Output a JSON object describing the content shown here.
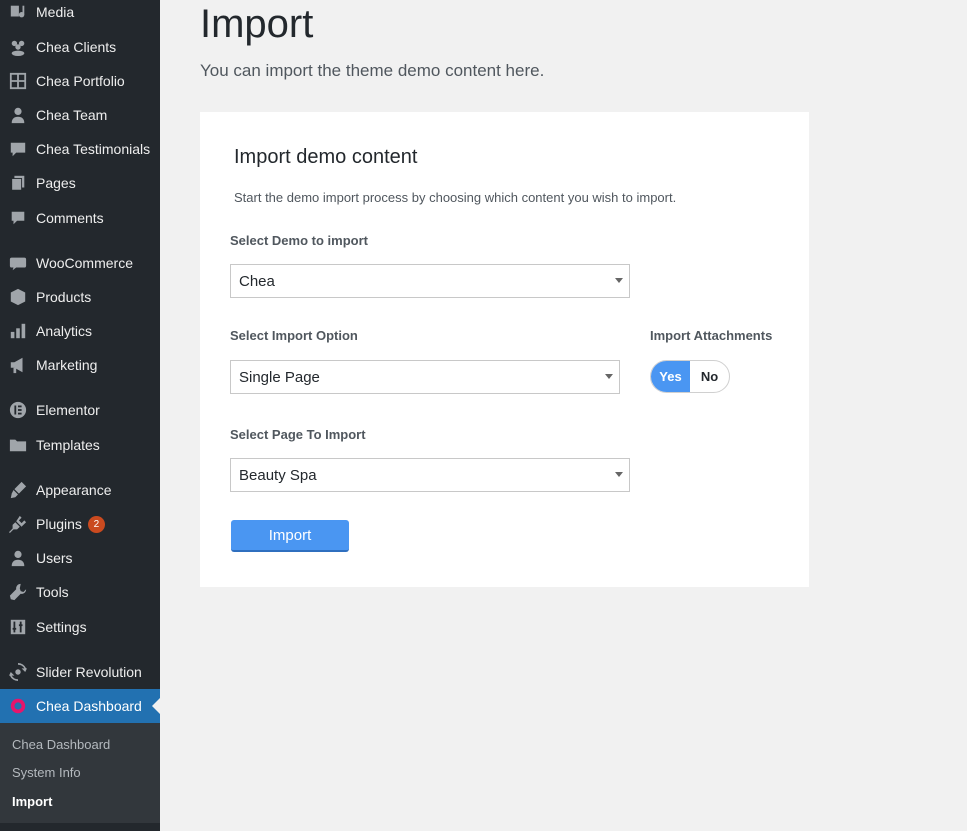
{
  "sidebar": {
    "items": [
      {
        "label": "Media",
        "icon": "media-icon"
      },
      {
        "label": "Chea Clients",
        "icon": "clients-icon"
      },
      {
        "label": "Chea Portfolio",
        "icon": "portfolio-icon"
      },
      {
        "label": "Chea Team",
        "icon": "team-icon"
      },
      {
        "label": "Chea Testimonials",
        "icon": "testimonials-icon"
      },
      {
        "label": "Pages",
        "icon": "pages-icon"
      },
      {
        "label": "Comments",
        "icon": "comments-icon"
      },
      {
        "label": "WooCommerce",
        "icon": "woocommerce-icon"
      },
      {
        "label": "Products",
        "icon": "products-icon"
      },
      {
        "label": "Analytics",
        "icon": "analytics-icon"
      },
      {
        "label": "Marketing",
        "icon": "marketing-icon"
      },
      {
        "label": "Elementor",
        "icon": "elementor-icon"
      },
      {
        "label": "Templates",
        "icon": "templates-icon"
      },
      {
        "label": "Appearance",
        "icon": "appearance-icon"
      },
      {
        "label": "Plugins",
        "icon": "plugins-icon",
        "badge": "2"
      },
      {
        "label": "Users",
        "icon": "users-icon"
      },
      {
        "label": "Tools",
        "icon": "tools-icon"
      },
      {
        "label": "Settings",
        "icon": "settings-icon"
      },
      {
        "label": "Slider Revolution",
        "icon": "slider-revolution-icon"
      },
      {
        "label": "Chea Dashboard",
        "icon": "chea-dashboard-icon",
        "active": true
      }
    ],
    "submenu": [
      "Chea Dashboard",
      "System Info",
      "Import"
    ],
    "submenu_current": "Import"
  },
  "page": {
    "title": "Import",
    "subtitle": "You can import the theme demo content here."
  },
  "panel": {
    "title": "Import demo content",
    "description": "Start the demo import process by choosing which content you wish to import.",
    "demo_label": "Select Demo to import",
    "demo_value": "Chea",
    "option_label": "Select Import Option",
    "option_value": "Single Page",
    "attachments_label": "Import Attachments",
    "toggle_yes": "Yes",
    "toggle_no": "No",
    "toggle_selected": "Yes",
    "page_label": "Select Page To Import",
    "page_value": "Beauty Spa",
    "import_button": "Import"
  },
  "colors": {
    "sidebar_bg": "#23282d",
    "active_bg": "#2271b1",
    "accent": "#4a96f2",
    "badge": "#ca4a1f"
  }
}
